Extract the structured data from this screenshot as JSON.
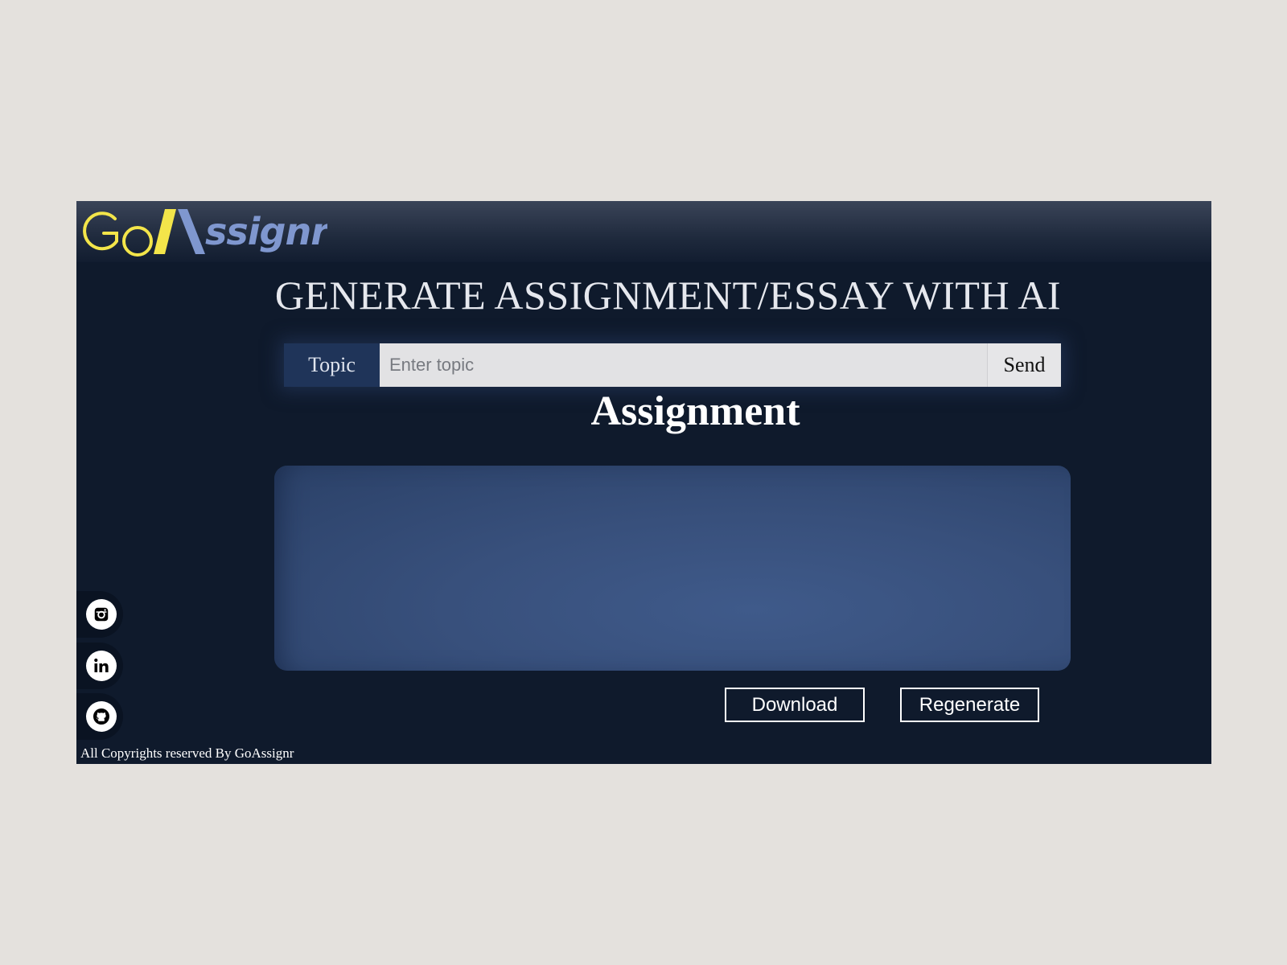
{
  "brand": {
    "name": "GoAssignr"
  },
  "main": {
    "title": "GENERATE ASSIGNMENT/ESSAY WITH AI",
    "topic_label": "Topic",
    "topic_placeholder": "Enter topic",
    "topic_value": "",
    "send_label": "Send",
    "section_title": "Assignment",
    "output_text": "",
    "download_label": "Download",
    "regenerate_label": "Regenerate"
  },
  "social": [
    {
      "icon": "instagram-icon"
    },
    {
      "icon": "linkedin-icon"
    },
    {
      "icon": "github-icon"
    }
  ],
  "footer": {
    "copyright": "All Copyrights reserved By GoAssignr"
  },
  "colors": {
    "page_bg": "#e4e1dd",
    "app_bg": "#0f1a2c",
    "logo_yellow": "#f3e54a",
    "logo_blue": "#7f97cf",
    "topic_label_bg": "#1f3459",
    "output_box": "#3a5282"
  }
}
